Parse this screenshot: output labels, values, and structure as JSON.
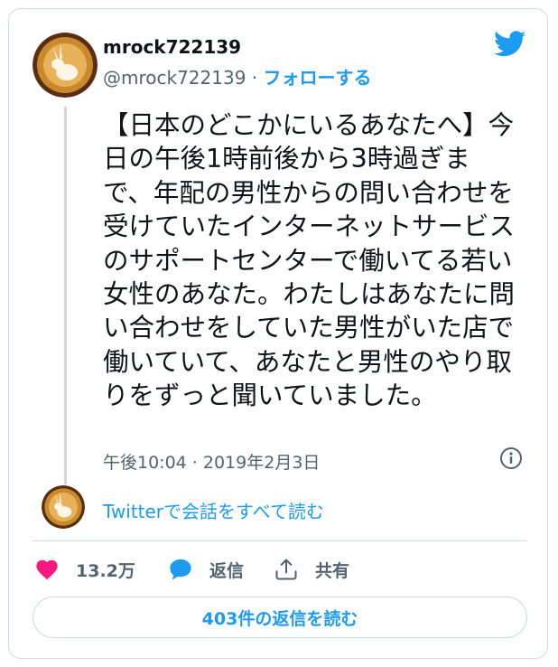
{
  "tweet": {
    "display_name": "mrock722139",
    "handle": "@mrock722139",
    "separator": "·",
    "follow_label": "フォローする",
    "text": "【日本のどこかにいるあなたへ】今日の午後1時前後から3時過ぎまで、年配の男性からの問い合わせを受けていたインターネットサービスのサポートセンターで働いてる若い女性のあなた。わたしはあなたに問い合わせをしていた男性がいた店で働いていて、あなたと男性のやり取りをずっと聞いていました。",
    "timestamp": "午後10:04 · 2019年2月3日"
  },
  "conversation_link": "Twitterで会話をすべて読む",
  "actions": {
    "like_count": "13.2万",
    "reply_label": "返信",
    "share_label": "共有"
  },
  "read_replies_label": "403件の返信を読む",
  "icons": {
    "brand": "twitter-bird-icon",
    "info": "info-icon",
    "like": "heart-icon",
    "reply": "speech-bubble-icon",
    "share": "share-icon"
  },
  "colors": {
    "accent": "#1d9bf0",
    "like": "#f91880",
    "text": "#0f1419",
    "muted": "#536471",
    "border": "#cfd9de"
  }
}
